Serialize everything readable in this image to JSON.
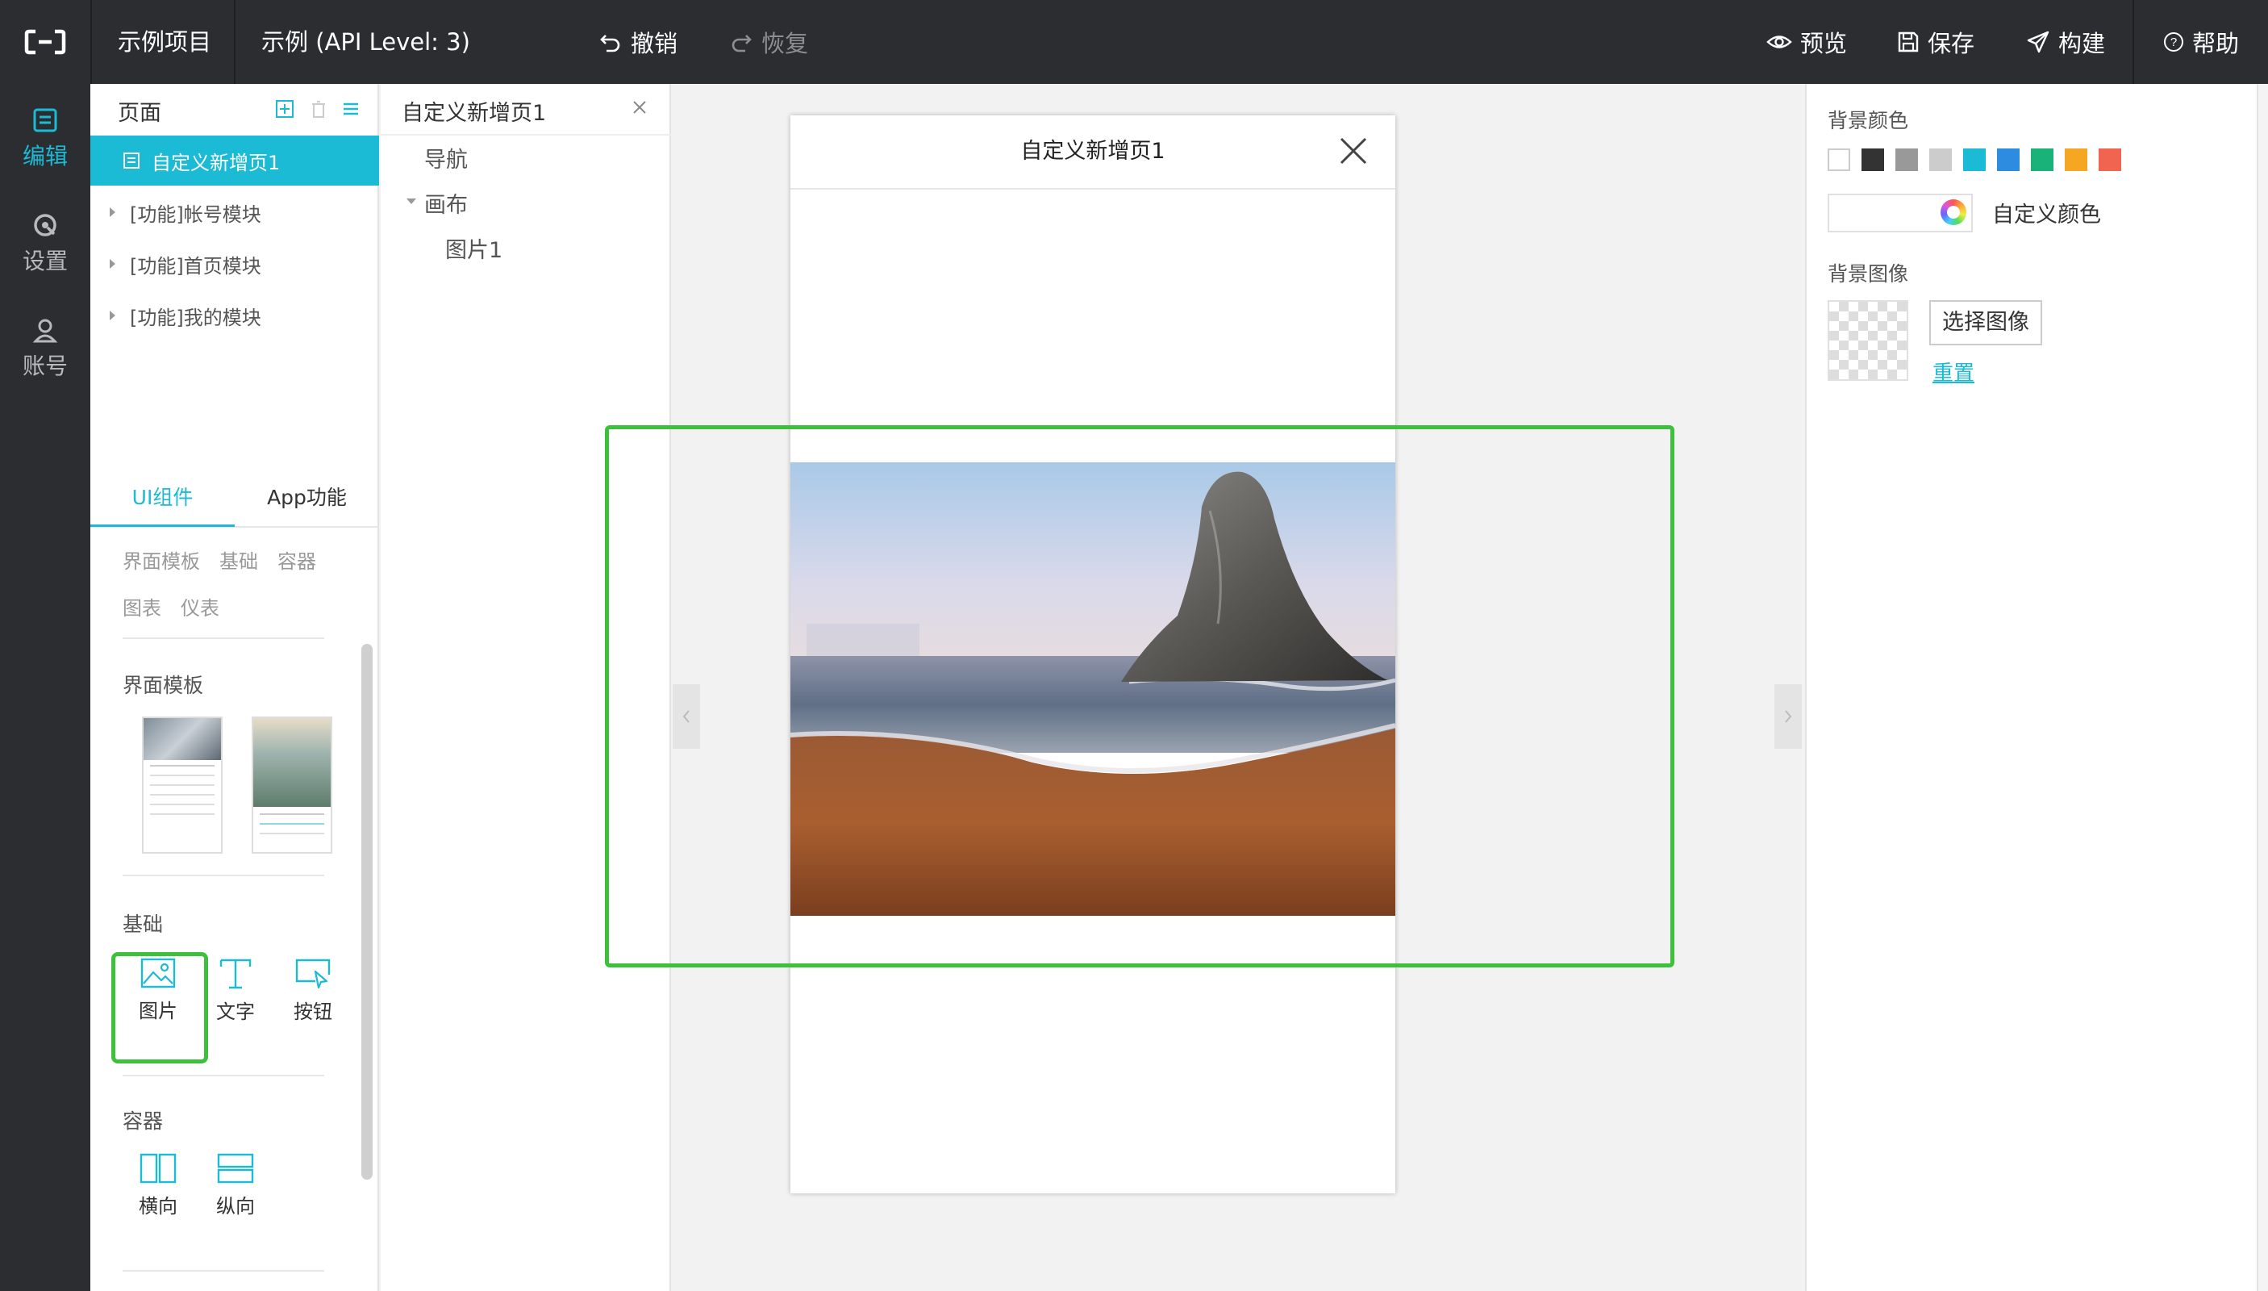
{
  "topbar": {
    "project_name": "示例项目",
    "app_title": "示例 (API Level: 3)",
    "undo_label": "撤销",
    "redo_label": "恢复",
    "preview_label": "预览",
    "save_label": "保存",
    "build_label": "构建",
    "help_label": "帮助"
  },
  "rail": {
    "edit_label": "编辑",
    "settings_label": "设置",
    "account_label": "账号"
  },
  "pages_panel": {
    "title": "页面",
    "items": [
      {
        "label": "自定义新增页1"
      },
      {
        "label": "[功能]帐号模块"
      },
      {
        "label": "[功能]首页模块"
      },
      {
        "label": "[功能]我的模块"
      }
    ]
  },
  "palette": {
    "tabs": [
      {
        "label": "UI组件"
      },
      {
        "label": "App功能"
      }
    ],
    "categories": [
      {
        "label": "界面模板"
      },
      {
        "label": "基础"
      },
      {
        "label": "容器"
      },
      {
        "label": "图表"
      },
      {
        "label": "仪表"
      }
    ],
    "templates_title": "界面模板",
    "basic_title": "基础",
    "basic_items": [
      {
        "label": "图片"
      },
      {
        "label": "文字"
      },
      {
        "label": "按钮"
      }
    ],
    "container_title": "容器",
    "container_items": [
      {
        "label": "横向"
      },
      {
        "label": "纵向"
      }
    ]
  },
  "outline": {
    "page_tab": "自定义新增页1",
    "nav_label": "导航",
    "canvas_label": "画布",
    "image_label": "图片1"
  },
  "phone": {
    "title": "自定义新增页1"
  },
  "props": {
    "bg_color_label": "背景颜色",
    "swatches": [
      "#ffffff",
      "#333333",
      "#999999",
      "#cccccc",
      "#1bbbd6",
      "#2d8ce0",
      "#19b37a",
      "#f5a623",
      "#f06450"
    ],
    "custom_color_label": "自定义颜色",
    "bg_image_label": "背景图像",
    "choose_image_label": "选择图像",
    "reset_label": "重置"
  },
  "colors": {
    "accent": "#1bbbd6",
    "topbar_bg": "#2b2d31",
    "highlight_green": "#3dc13c"
  }
}
